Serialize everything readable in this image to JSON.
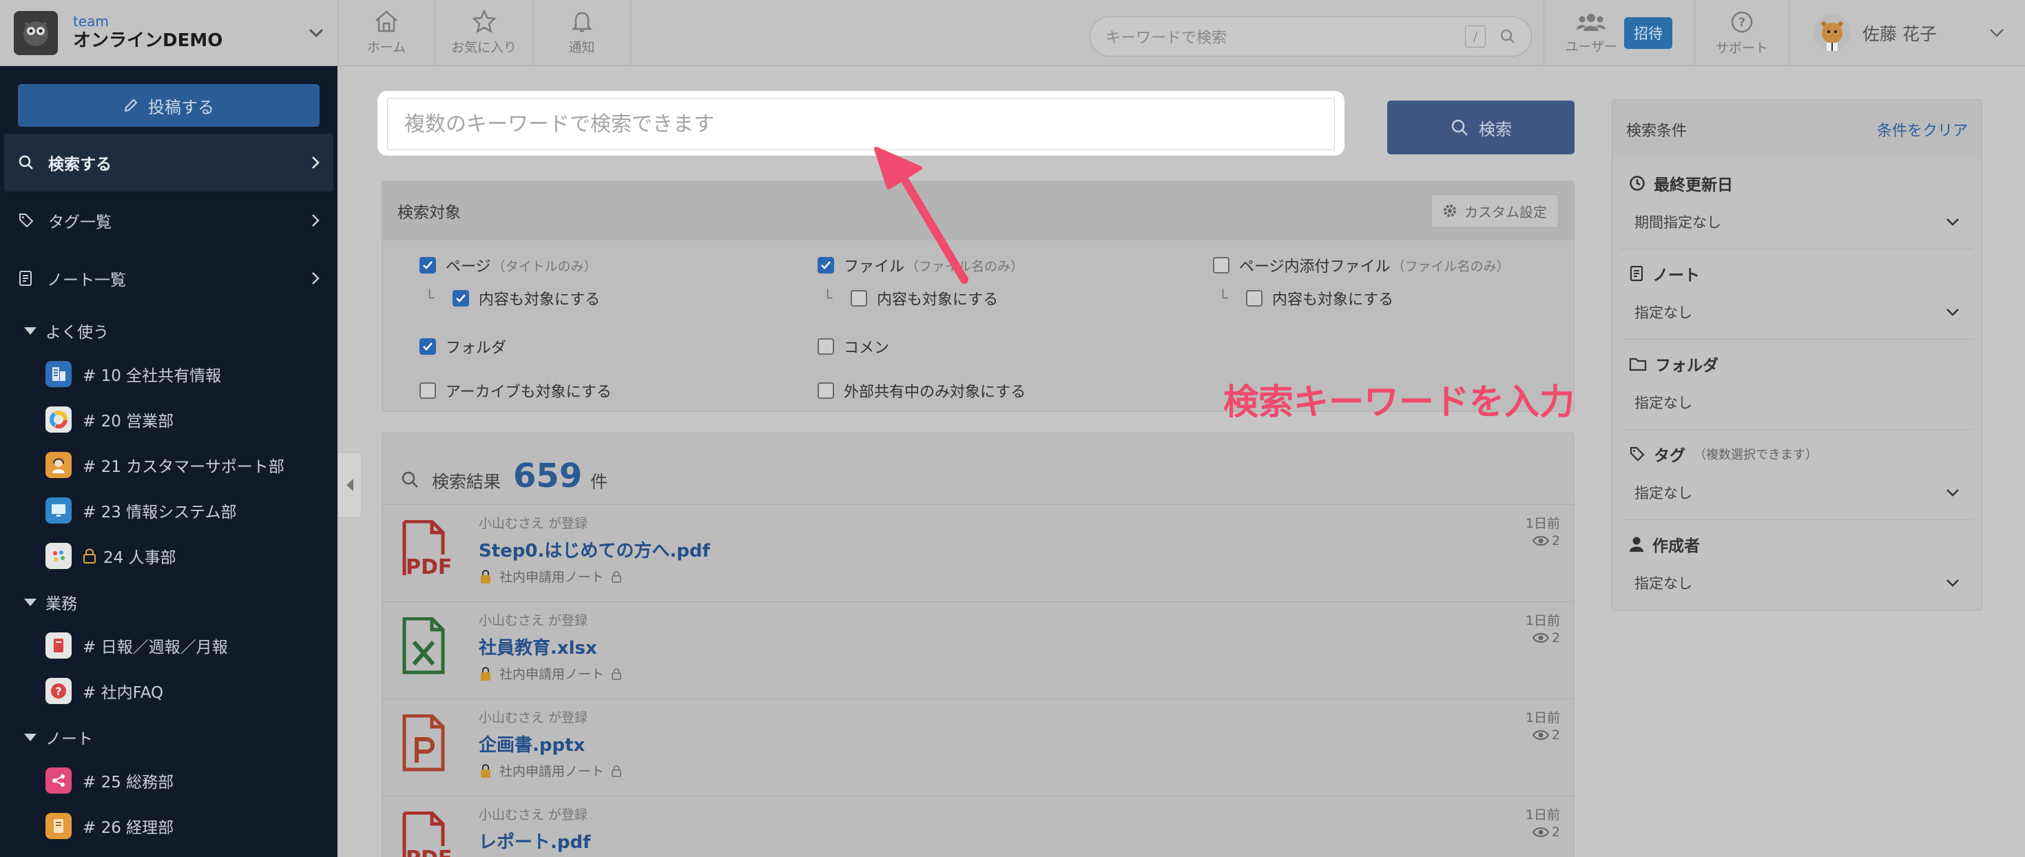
{
  "team": {
    "label": "team",
    "name": "オンラインDEMO"
  },
  "sidebar": {
    "post_label": "投稿する",
    "nav": [
      {
        "label": "検索する",
        "icon": "search-icon"
      },
      {
        "label": "タグ一覧",
        "icon": "tag-icon"
      },
      {
        "label": "ノート一覧",
        "icon": "notebook-icon"
      }
    ],
    "sections": [
      {
        "title": "よく使う",
        "items": [
          {
            "label": "# 10 全社共有情報",
            "icon": "building-icon",
            "color": "#2f6fb8"
          },
          {
            "label": "# 20 営業部",
            "icon": "chart-ring-icon",
            "color": "#e7e7e7"
          },
          {
            "label": "# 21 カスタマーサポート部",
            "icon": "support-person-icon",
            "color": "#e39a38"
          },
          {
            "label": "# 23 情報システム部",
            "icon": "monitor-icon",
            "color": "#2f87c9"
          },
          {
            "label": "24 人事部",
            "icon": "palette-icon",
            "color": "#e6e6e6"
          }
        ]
      },
      {
        "title": "業務",
        "items": [
          {
            "label": "# 日報／週報／月報",
            "icon": "book-icon",
            "color": "#d94343"
          },
          {
            "label": "# 社内FAQ",
            "icon": "question-icon",
            "color": "#d94343"
          }
        ]
      },
      {
        "title": "ノート",
        "items": [
          {
            "label": "# 25 総務部",
            "icon": "share-icon",
            "color": "#e24a7c"
          },
          {
            "label": "# 26 経理部",
            "icon": "ledger-icon",
            "color": "#e39a38"
          }
        ]
      }
    ]
  },
  "header": {
    "nav": [
      {
        "label": "ホーム",
        "icon": "home-icon"
      },
      {
        "label": "お気に入り",
        "icon": "star-icon"
      },
      {
        "label": "通知",
        "icon": "bell-icon"
      }
    ],
    "search_placeholder": "キーワードで検索",
    "search_shortcut": "/",
    "users_label": "ユーザー",
    "invite_label": "招待",
    "support_label": "サポート",
    "user_name": "佐藤 花子"
  },
  "search": {
    "placeholder": "複数のキーワードで検索できます",
    "button_label": "検索"
  },
  "targets": {
    "title": "検索対象",
    "custom_label": "カスタム設定",
    "options": {
      "page": {
        "label": "ページ",
        "note": "（タイトルのみ）",
        "checked": true
      },
      "page_content": {
        "label": "内容も対象にする",
        "checked": true
      },
      "file": {
        "label": "ファイル",
        "note": "（ファイル名のみ）",
        "checked": true
      },
      "file_content": {
        "label": "内容も対象にする",
        "checked": false
      },
      "attach": {
        "label": "ページ内添付ファイル",
        "note": "（ファイル名のみ）",
        "checked": false
      },
      "attach_content": {
        "label": "内容も対象にする",
        "checked": false
      },
      "folder": {
        "label": "フォルダ",
        "checked": true
      },
      "comment": {
        "label": "コメン",
        "checked": false
      },
      "archive": {
        "label": "アーカイブも対象にする",
        "checked": false
      },
      "external": {
        "label": "外部共有中のみ対象にする",
        "checked": false
      }
    }
  },
  "results": {
    "label": "検索結果",
    "count": "659",
    "unit": "件",
    "items": [
      {
        "registered": "小山むさえ が登録",
        "name": "Step0.はじめての方へ.pdf",
        "note": "社内申請用ノート",
        "date": "1日前",
        "views": "2",
        "type": "pdf"
      },
      {
        "registered": "小山むさえ が登録",
        "name": "社員教育.xlsx",
        "note": "社内申請用ノート",
        "date": "1日前",
        "views": "2",
        "type": "xlsx"
      },
      {
        "registered": "小山むさえ が登録",
        "name": "企画書.pptx",
        "note": "社内申請用ノート",
        "date": "1日前",
        "views": "2",
        "type": "pptx"
      },
      {
        "registered": "小山むさえ が登録",
        "name": "レポート.pdf",
        "note": "",
        "date": "1日前",
        "views": "2",
        "type": "pdf"
      }
    ]
  },
  "conditions": {
    "title": "検索条件",
    "clear_label": "条件をクリア",
    "sections": [
      {
        "title": "最終更新日",
        "value": "期間指定なし",
        "icon": "clock-icon"
      },
      {
        "title": "ノート",
        "value": "指定なし",
        "icon": "notebook-icon"
      },
      {
        "title": "フォルダ",
        "value": "指定なし",
        "icon": "folder-icon"
      },
      {
        "title": "タグ",
        "sub": "（複数選択できます）",
        "value": "指定なし",
        "icon": "tag-icon"
      },
      {
        "title": "作成者",
        "value": "指定なし",
        "icon": "person-icon"
      }
    ]
  },
  "annotation": {
    "text": "検索キーワードを入力",
    "color": "#f04a6e"
  }
}
